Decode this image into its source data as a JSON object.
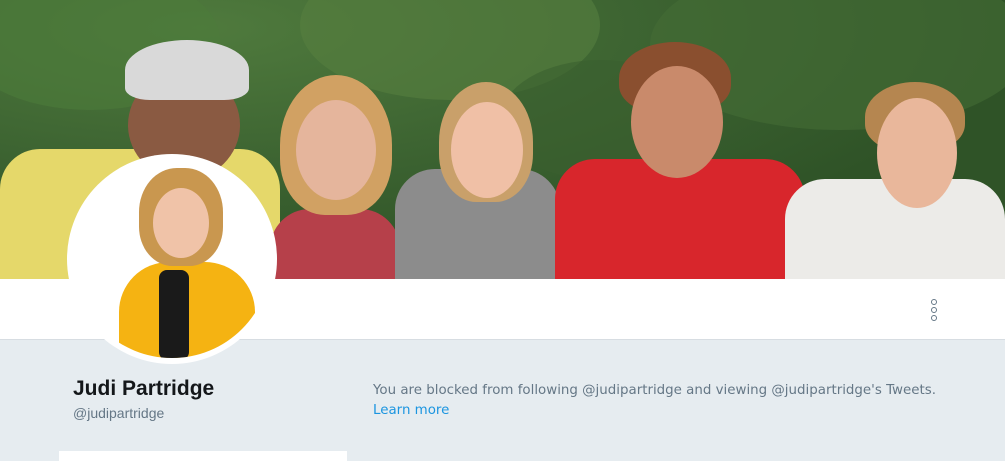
{
  "profile": {
    "name": "Judi Partridge",
    "handle": "@judipartridge"
  },
  "blocked_notice": {
    "text": "You are blocked from following @judipartridge and viewing @judipartridge's Tweets.",
    "link_label": "Learn more"
  },
  "icons": {
    "more": "more-vertical-icon"
  },
  "colors": {
    "page_background": "#e6ecf0",
    "link": "#1b95e0",
    "secondary_text": "#657786",
    "name_text": "#14171a"
  }
}
